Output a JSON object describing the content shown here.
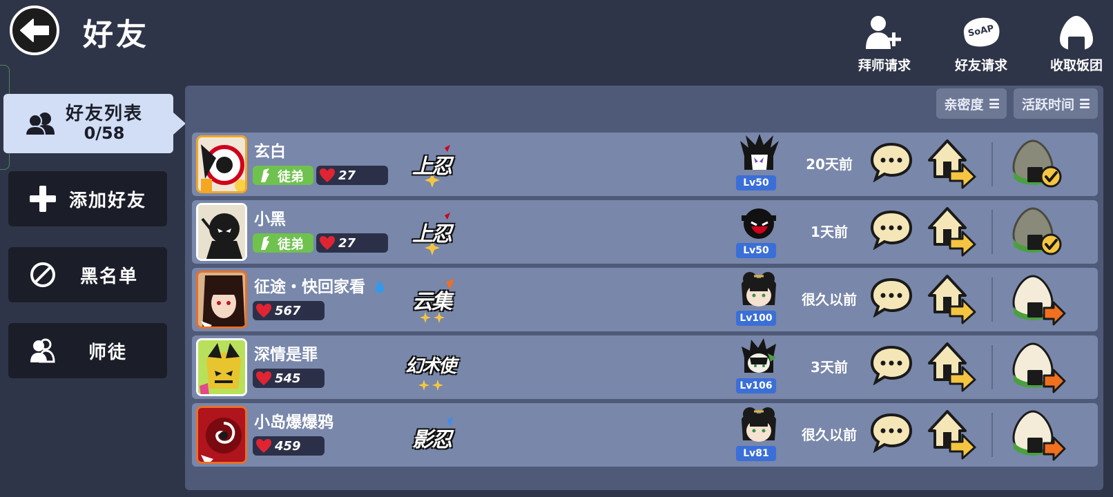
{
  "header": {
    "title": "好友",
    "actions": [
      {
        "label": "拜师请求",
        "icon": "add-user-icon"
      },
      {
        "label": "好友请求",
        "icon": "soap-icon",
        "icon_text": "SoAP"
      },
      {
        "label": "收取饭团",
        "icon": "rice-ball-icon"
      }
    ]
  },
  "sidebar": {
    "items": [
      {
        "label": "好友列表",
        "count": "0/58",
        "icon": "friends-icon",
        "active": true
      },
      {
        "label": "添加好友",
        "icon": "plus-icon"
      },
      {
        "label": "黑名单",
        "icon": "block-icon"
      },
      {
        "label": "师徒",
        "icon": "mentor-icon"
      }
    ]
  },
  "sort": {
    "intimacy_label": "亲密度",
    "active_time_label": "活跃时间"
  },
  "colors": {
    "background": "#2f3548",
    "panel": "#4f5a78",
    "row": "#7887aa",
    "apprentice_green": "#6fc24e",
    "level_blue": "#3b6fd8"
  },
  "friends": [
    {
      "name": "玄白",
      "apprentice_label": "徒弟",
      "intimacy": "27",
      "rank": "上忍",
      "level": "Lv50",
      "last_active": "20天前",
      "rice_collected": true
    },
    {
      "name": "小黑",
      "apprentice_label": "徒弟",
      "intimacy": "27",
      "rank": "上忍",
      "level": "Lv50",
      "last_active": "1天前",
      "rice_collected": true
    },
    {
      "name": "征途・快回家看",
      "intimacy": "567",
      "rank": "云集",
      "level": "Lv100",
      "last_active": "很久以前",
      "rice_collected": false
    },
    {
      "name": "深情是罪",
      "intimacy": "545",
      "rank": "幻术使",
      "level": "Lv106",
      "last_active": "3天前",
      "rice_collected": false
    },
    {
      "name": "小岛爆爆鸦",
      "intimacy": "459",
      "rank": "影忍",
      "level": "Lv81",
      "last_active": "很久以前",
      "rice_collected": false
    }
  ]
}
